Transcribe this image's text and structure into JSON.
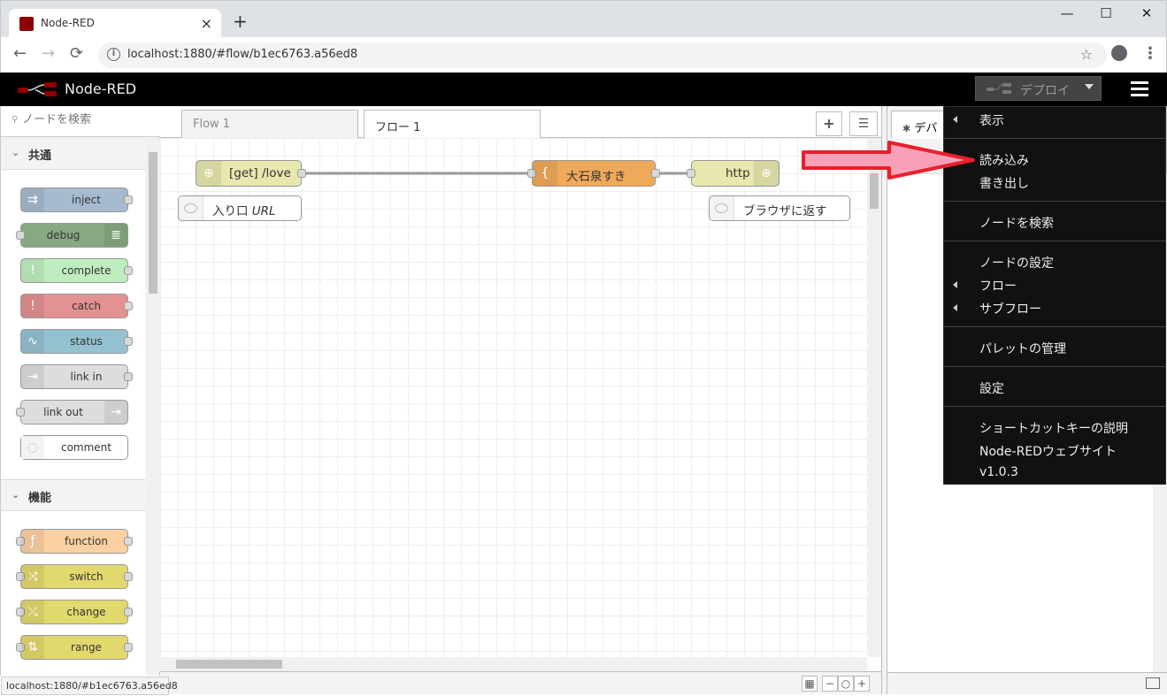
{
  "browser": {
    "tab_title": "Node-RED",
    "tab_close": "×",
    "new_tab": "+",
    "url": "localhost:1880/#flow/b1ec6763.a56ed8",
    "status_url": "localhost:1880/#b1ec6763.a56ed8",
    "window_controls": {
      "minimize": "—",
      "maximize": "☐",
      "close": "✕"
    },
    "nav": {
      "back": "←",
      "forward": "→",
      "reload": "⟳"
    },
    "icons": {
      "star": "☆",
      "kebab": "⋮",
      "info": "i"
    }
  },
  "header": {
    "title": "Node-RED",
    "deploy_label": "デプロイ"
  },
  "palette": {
    "search_placeholder": "ノードを検索",
    "search_icon": "⚲",
    "categories": [
      {
        "label": "共通",
        "chevron": "⌄",
        "nodes": [
          {
            "label": "inject",
            "icon": "⇉",
            "color": "#a6bbcf"
          },
          {
            "label": "debug",
            "icon": "≣",
            "color": "#87a980"
          },
          {
            "label": "complete",
            "icon": "!",
            "color": "#c0edc0"
          },
          {
            "label": "catch",
            "icon": "!",
            "color": "#e49191"
          },
          {
            "label": "status",
            "icon": "∿",
            "color": "#94c1d0"
          },
          {
            "label": "link in",
            "icon": "⇥",
            "color": "#dddddd"
          },
          {
            "label": "link out",
            "icon": "⇥",
            "color": "#dddddd"
          },
          {
            "label": "comment",
            "icon": "◌",
            "color": "#ffffff"
          }
        ]
      },
      {
        "label": "機能",
        "chevron": "⌄",
        "nodes": [
          {
            "label": "function",
            "icon": "ƒ",
            "color": "#fdd0a2"
          },
          {
            "label": "switch",
            "icon": "⤨",
            "color": "#e2d96e"
          },
          {
            "label": "change",
            "icon": "⤯",
            "color": "#e2d96e"
          },
          {
            "label": "range",
            "icon": "⇅",
            "color": "#e2d96e"
          }
        ]
      }
    ]
  },
  "workspace": {
    "tabs": [
      {
        "label": "Flow 1"
      },
      {
        "label": "フロー 1"
      }
    ],
    "add_label": "+",
    "list_label": "☰",
    "flow_nodes": {
      "http_in": {
        "label": "[get] /love",
        "icon": "⊕",
        "color": "#e7e7ae"
      },
      "template": {
        "label": "大石泉すき",
        "icon": "{",
        "color": "#efa95a"
      },
      "http_response": {
        "label": "http",
        "icon": "⊕",
        "color": "#e7e7ae"
      }
    },
    "comments": [
      {
        "label": "入り口",
        "label_italic": "URL"
      },
      {
        "label": "ブラウザに返す",
        "label_italic": ""
      }
    ],
    "zoom_controls": {
      "map": "▦",
      "minus": "−",
      "reset": "○",
      "plus": "+"
    }
  },
  "sidebar": {
    "tab_label": "デバ",
    "tab_icon": "✱"
  },
  "menu": {
    "items": [
      {
        "label": "表示",
        "submenu": true
      },
      {
        "label": "読み込み",
        "submenu": false
      },
      {
        "label": "書き出し",
        "submenu": false
      },
      {
        "label": "ノードを検索",
        "submenu": false
      },
      {
        "label": "ノードの設定",
        "submenu": false
      },
      {
        "label": "フロー",
        "submenu": true
      },
      {
        "label": "サブフロー",
        "submenu": true
      },
      {
        "label": "パレットの管理",
        "submenu": false
      },
      {
        "label": "設定",
        "submenu": false
      },
      {
        "label": "ショートカットキーの説明",
        "submenu": false
      },
      {
        "label": "Node-REDウェブサイト",
        "submenu": false
      },
      {
        "label": "v1.0.3",
        "submenu": false
      }
    ]
  },
  "colors": {
    "header_bg": "#000000",
    "menu_bg": "#111111",
    "arrow_fill": "#f8a0b8",
    "arrow_stroke": "#e8202a",
    "wire": "#999999",
    "port_fill": "#d9d9d9"
  }
}
